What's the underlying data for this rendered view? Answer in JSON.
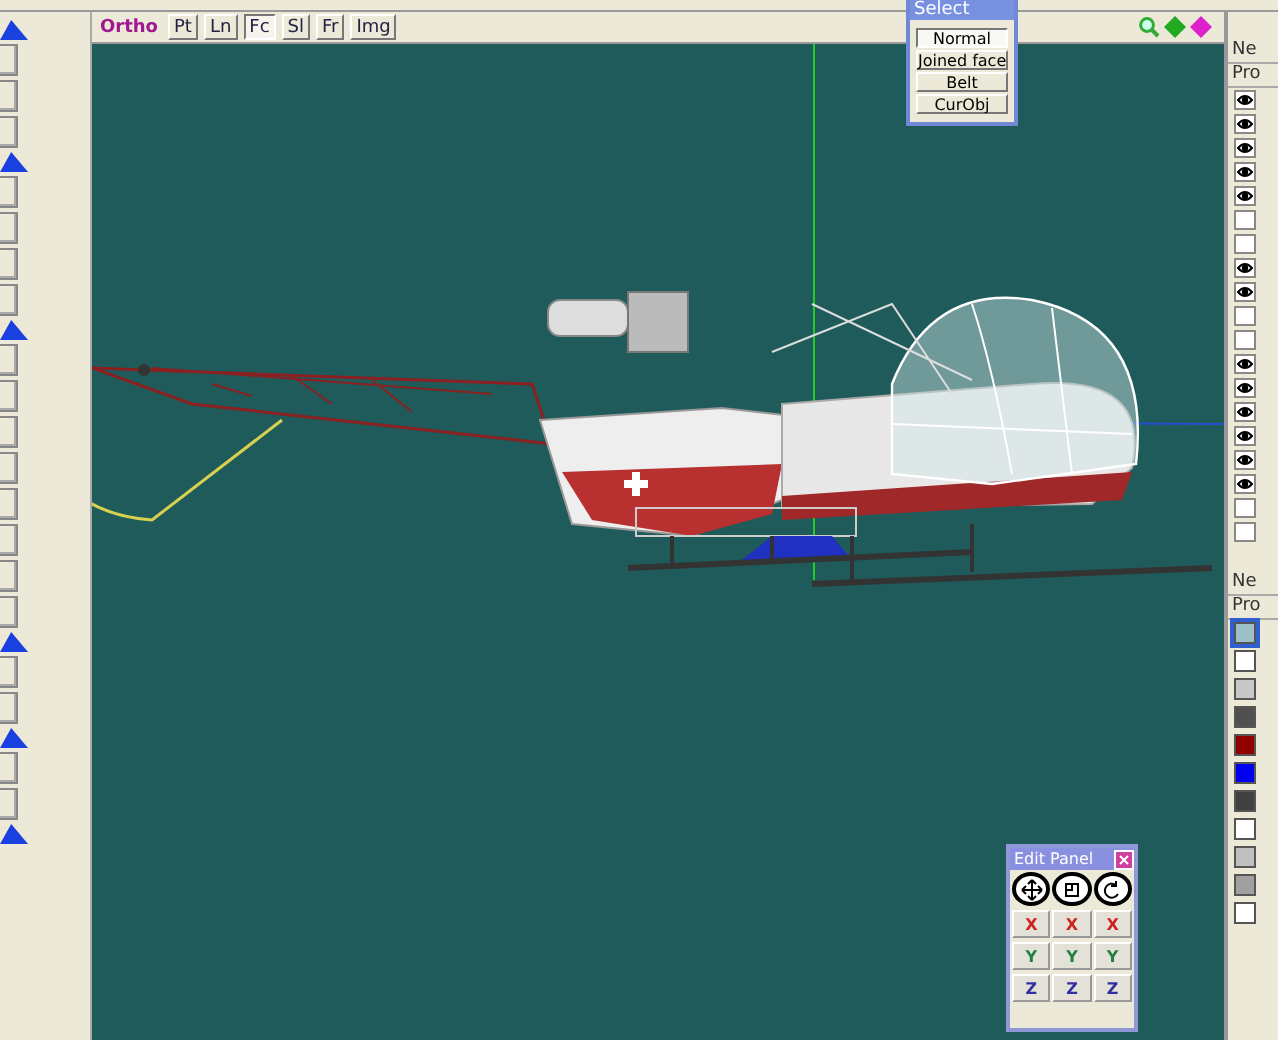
{
  "projection": "Ortho",
  "display_toggles": [
    {
      "label": "Pt",
      "on": false
    },
    {
      "label": "Ln",
      "on": false
    },
    {
      "label": "Fc",
      "on": true
    },
    {
      "label": "Sl",
      "on": false
    },
    {
      "label": "Fr",
      "on": false
    },
    {
      "label": "Img",
      "on": false
    }
  ],
  "select_panel": {
    "title": "Select",
    "buttons": [
      {
        "label": "Normal",
        "selected": true
      },
      {
        "label": "Joined face",
        "selected": false
      },
      {
        "label": "Belt",
        "selected": false
      },
      {
        "label": "CurObj",
        "selected": false
      }
    ]
  },
  "object_panel": {
    "header": "Ne",
    "subheader": "Pro",
    "objects": [
      {
        "visible": true
      },
      {
        "visible": true
      },
      {
        "visible": true
      },
      {
        "visible": true
      },
      {
        "visible": true
      },
      {
        "visible": false
      },
      {
        "visible": false
      },
      {
        "visible": true
      },
      {
        "visible": true
      },
      {
        "visible": false
      },
      {
        "visible": false
      },
      {
        "visible": true
      },
      {
        "visible": true
      },
      {
        "visible": true
      },
      {
        "visible": true
      },
      {
        "visible": true
      },
      {
        "visible": true
      },
      {
        "visible": false
      },
      {
        "visible": false
      }
    ]
  },
  "material_panel": {
    "header": "Ne",
    "subheader": "Pro",
    "materials": [
      {
        "color": "#9cc0c8",
        "selected": true
      },
      {
        "color": "#ffffff",
        "selected": false
      },
      {
        "color": "#c8c8c8",
        "selected": false
      },
      {
        "color": "#505050",
        "selected": false
      },
      {
        "color": "#900000",
        "selected": false
      },
      {
        "color": "#0000f0",
        "selected": false
      },
      {
        "color": "#404040",
        "selected": false
      },
      {
        "color": "#ffffff",
        "selected": false
      },
      {
        "color": "#c0c0c0",
        "selected": false
      },
      {
        "color": "#a0a0a0",
        "selected": false
      },
      {
        "color": "#ffffff",
        "selected": false
      }
    ]
  },
  "edit_panel": {
    "title": "Edit Panel",
    "tools": [
      {
        "kind": "move"
      },
      {
        "kind": "scale"
      },
      {
        "kind": "rotate"
      }
    ],
    "axis_rows": [
      {
        "color": "#d02020",
        "buttons": [
          "X",
          "X",
          "X"
        ]
      },
      {
        "color": "#208040",
        "buttons": [
          "Y",
          "Y",
          "Y"
        ]
      },
      {
        "color": "#3030a0",
        "buttons": [
          "Z",
          "Z",
          "Z"
        ]
      }
    ]
  }
}
